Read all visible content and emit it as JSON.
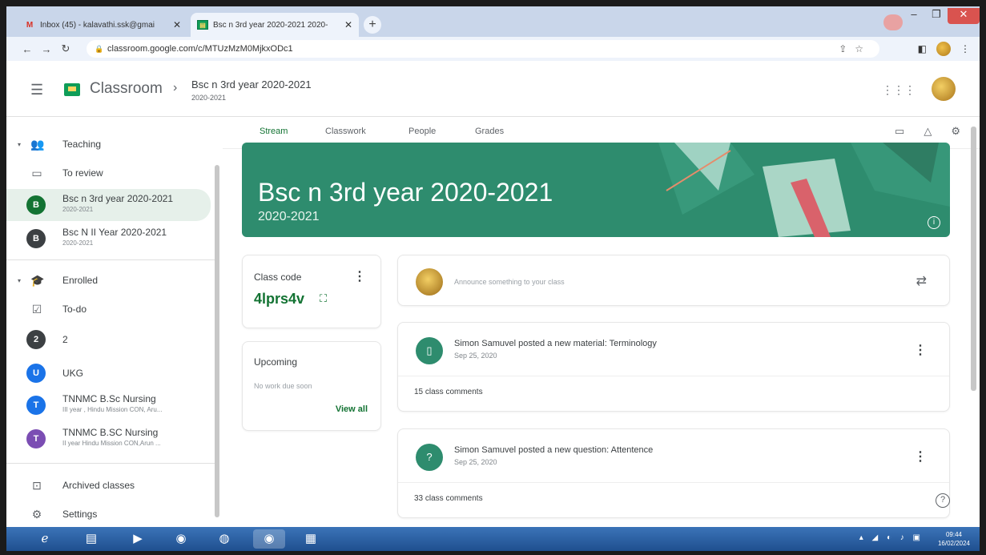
{
  "browser": {
    "tabs": [
      {
        "title": "Inbox (45) - kalavathi.ssk@gmai",
        "favicon": "gmail-icon"
      },
      {
        "title": "Bsc n 3rd year 2020-2021 2020-",
        "favicon": "classroom-icon"
      }
    ],
    "url": "classroom.google.com/c/MTUzMzM0MjkxODc1"
  },
  "app": {
    "brand": "Classroom",
    "class_title": "Bsc n 3rd year 2020-2021",
    "class_subtitle": "2020-2021"
  },
  "sidebar": {
    "teaching_label": "Teaching",
    "to_review_label": "To review",
    "teaching_classes": [
      {
        "initial": "B",
        "name": "Bsc n 3rd year 2020-2021",
        "sub": "2020-2021",
        "color": "#137333"
      },
      {
        "initial": "B",
        "name": "Bsc N II Year 2020-2021",
        "sub": "2020-2021",
        "color": "#3c4043"
      }
    ],
    "enrolled_label": "Enrolled",
    "todo_label": "To-do",
    "enrolled_classes": [
      {
        "initial": "2",
        "name": "2",
        "sub": "",
        "color": "#3c4043"
      },
      {
        "initial": "U",
        "name": "UKG",
        "sub": "",
        "color": "#1a73e8"
      },
      {
        "initial": "T",
        "name": "TNNMC B.Sc Nursing",
        "sub": "III year , Hindu Mission CON, Aru...",
        "color": "#1a73e8"
      },
      {
        "initial": "T",
        "name": "TNNMC B.SC Nursing",
        "sub": "II year Hindu Mission CON,Arun ...",
        "color": "#7b4db3"
      }
    ],
    "archived_label": "Archived classes",
    "settings_label": "Settings"
  },
  "tabs": [
    "Stream",
    "Classwork",
    "People",
    "Grades"
  ],
  "banner": {
    "title": "Bsc n 3rd year 2020-2021",
    "subtitle": "2020-2021",
    "color": "#2e8c6e"
  },
  "class_code": {
    "label": "Class code",
    "code": "4lprs4v"
  },
  "upcoming": {
    "label": "Upcoming",
    "empty_text": "No work due soon",
    "view_all": "View all"
  },
  "announce": {
    "placeholder": "Announce something to your class"
  },
  "posts": [
    {
      "title": "Simon Samuvel posted a new material: Terminology",
      "date": "Sep 25, 2020",
      "comments": "15 class comments",
      "icon": "material-icon"
    },
    {
      "title": "Simon Samuvel posted a new question: Attentence",
      "date": "Sep 25, 2020",
      "comments": "33 class comments",
      "icon": "question-icon"
    }
  ],
  "taskbar": {
    "time": "09:44",
    "date": "16/02/2024"
  },
  "colors": {
    "accent": "#137333",
    "banner": "#2e8c6e"
  }
}
